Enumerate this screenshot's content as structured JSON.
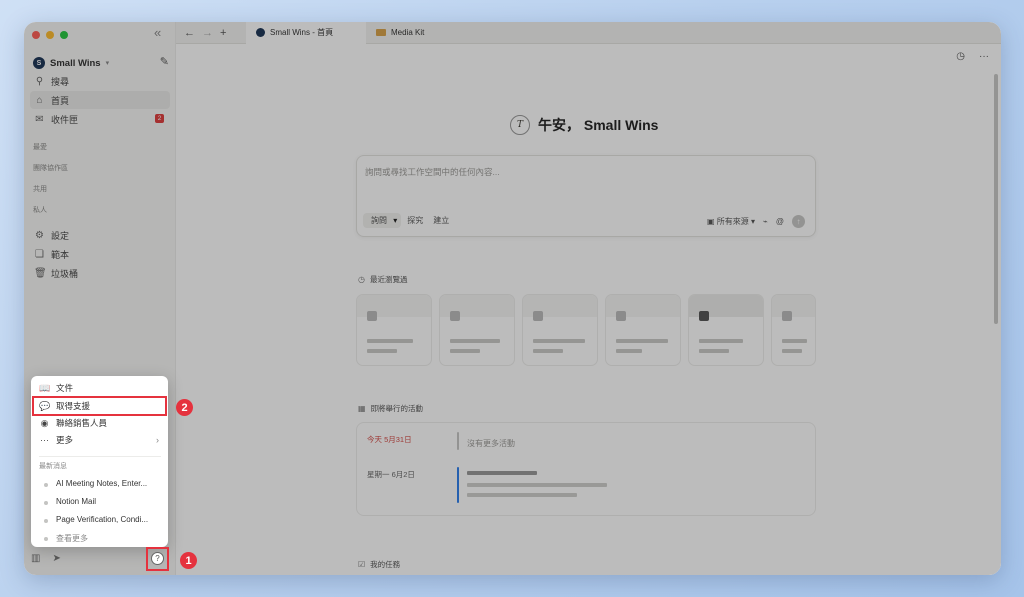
{
  "window": {
    "traffic_colors": [
      "#ff5f57",
      "#febc2e",
      "#28c840"
    ]
  },
  "sidebar": {
    "collapse_icon": "double-chevron-left-icon",
    "workspace": {
      "logo_letter": "S",
      "name": "Small Wins"
    },
    "nav": [
      {
        "icon": "search-icon",
        "label": "搜尋"
      },
      {
        "icon": "home-icon",
        "label": "首頁"
      },
      {
        "icon": "inbox-icon",
        "label": "收件匣",
        "badge": "2"
      }
    ],
    "sections": [
      "最愛",
      "團隊協作區",
      "共用",
      "私人"
    ],
    "bottom_nav": [
      {
        "icon": "gear-icon",
        "label": "設定"
      },
      {
        "icon": "template-icon",
        "label": "範本"
      },
      {
        "icon": "trash-icon",
        "label": "垃圾桶"
      }
    ]
  },
  "tabs": [
    {
      "label": "Small Wins - 首頁",
      "active": true
    },
    {
      "label": "Media Kit",
      "active": false
    }
  ],
  "main": {
    "greeting": "午安，  Small Wins",
    "avatar_letter": "T",
    "ask": {
      "placeholder": "詢問或尋找工作空間中的任何內容...",
      "mode_selected": "詢問",
      "mode_options": [
        "探究",
        "建立"
      ],
      "source_label": "所有來源",
      "at_symbol": "@",
      "send_arrow": "↑"
    },
    "recent_title": "最近瀏覽過",
    "events_title": "即將舉行的活動",
    "events": {
      "today_label": "今天 5月31日",
      "today_text": "沒有更多活動",
      "next_label": "星期一 6月2日"
    },
    "tasks_title": "我的任務"
  },
  "help_menu": {
    "items": [
      {
        "icon": "book-icon",
        "label": "文件"
      },
      {
        "icon": "chat-bubble-icon",
        "label": "取得支援"
      },
      {
        "icon": "person-circle-icon",
        "label": "聯絡銷售人員"
      },
      {
        "icon": "more-dots-icon",
        "label": "更多"
      }
    ],
    "news_title": "最新消息",
    "news": [
      "AI Meeting Notes, Enter...",
      "Notion Mail",
      "Page Verification, Condi..."
    ],
    "see_more": "查看更多"
  },
  "annotations": {
    "marker_1": "1",
    "marker_2": "2",
    "highlight_color": "#e5323e"
  }
}
